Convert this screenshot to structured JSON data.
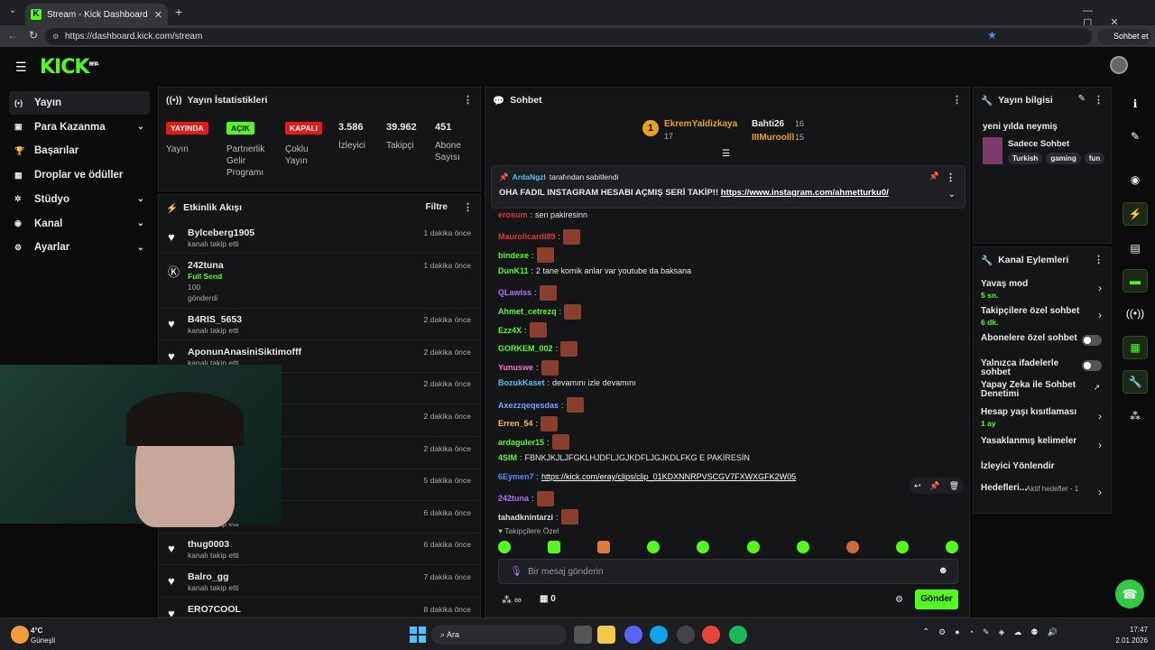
{
  "browser": {
    "tab_title": "Stream - Kick Dashboard",
    "url": "https://dashboard.kick.com/stream",
    "profile_label": "Sohbet et"
  },
  "header": {
    "logo": "KICK",
    "beta": "BETA"
  },
  "sidebar": {
    "items": [
      {
        "label": "Yayın",
        "icon": "stream-icon",
        "chevron": false
      },
      {
        "label": "Para Kazanma",
        "icon": "money-icon",
        "chevron": true
      },
      {
        "label": "Başarılar",
        "icon": "trophy-icon",
        "chevron": false
      },
      {
        "label": "Droplar ve ödüller",
        "icon": "gift-icon",
        "chevron": false
      },
      {
        "label": "Stüdyo",
        "icon": "studio-icon",
        "chevron": true
      },
      {
        "label": "Kanal",
        "icon": "channel-icon",
        "chevron": true
      },
      {
        "label": "Ayarlar",
        "icon": "gear-icon",
        "chevron": true
      }
    ]
  },
  "stats": {
    "title": "Yayın İstatistikleri",
    "items": [
      {
        "badge": "YAYINDA",
        "label": "Yayın"
      },
      {
        "badge": "AÇIK",
        "label": "Partnerlik Gelir Programı"
      },
      {
        "badge": "KAPALI",
        "label": "Çoklu Yayın"
      },
      {
        "value": "3.586",
        "label": "İzleyici"
      },
      {
        "value": "39.962",
        "label": "Takipçi"
      },
      {
        "value": "451",
        "label": "Abone Sayısı"
      }
    ]
  },
  "activity": {
    "title": "Etkinlik Akışı",
    "filter": "Filtre",
    "items": [
      {
        "name": "Bylceberg1905",
        "sub": "kanalı takip etti",
        "time": "1 dakika önce"
      },
      {
        "name": "242tuna",
        "sub": "Full Send",
        "extra": "100",
        "extra2": "gönderdi",
        "time": "1 dakika önce"
      },
      {
        "name": "B4RIS_5653",
        "sub": "kanalı takip etti",
        "time": "2 dakika önce"
      },
      {
        "name": "AponunAnasiniSiktimofff",
        "sub": "kanalı takip etti",
        "time": "2 dakika önce"
      },
      {
        "name": "",
        "sub": "",
        "time": "2 dakika önce"
      },
      {
        "name": "",
        "sub": "",
        "time": "2 dakika önce"
      },
      {
        "name": "",
        "sub": "",
        "time": "2 dakika önce"
      },
      {
        "name": "",
        "sub": "",
        "time": "5 dakika önce"
      },
      {
        "name": "",
        "sub": "kanalı takip etti",
        "time": "6 dakika önce"
      },
      {
        "name": "thug0003",
        "sub": "kanalı takip etti",
        "time": "6 dakika önce"
      },
      {
        "name": "Balro_gg",
        "sub": "kanalı takip etti",
        "time": "7 dakika önce"
      },
      {
        "name": "ERO7COOL",
        "sub": "",
        "time": "8 dakika önce"
      }
    ]
  },
  "chat": {
    "title": "Sohbet",
    "leaders": [
      {
        "name": "EkremYaldizkaya",
        "count": "17"
      },
      {
        "name": "Bahti26",
        "count": "16"
      },
      {
        "name": "IIIMuroolll",
        "count": "15"
      }
    ],
    "pinned_by": "ArdaNgzl",
    "pinned_suffix": "tarafından sabitlendi",
    "pinned_text": "OHA FADIL INSTAGRAM HESABI AÇMIŞ SERİ TAKİP!!",
    "pinned_link": "https://www.instagram.com/ahmetturku0/",
    "messages": [
      {
        "user": "erosum",
        "color": "#e0373a",
        "text": "sen pakiresinn",
        "emote": false
      },
      {
        "user": "Maurolicardi89",
        "color": "#e0373a",
        "text": "",
        "emote": true
      },
      {
        "user": "bindexe",
        "color": "#53fc18",
        "text": "",
        "emote": true
      },
      {
        "user": "DunK11",
        "color": "#53fc18",
        "text": "2 tane komik anlar var youtube da baksana",
        "emote": false
      },
      {
        "user": "QLawiss",
        "color": "#b66cff",
        "text": "",
        "emote": true
      },
      {
        "user": "Ahmet_cetrezq",
        "color": "#53fc18",
        "text": "",
        "emote": true
      },
      {
        "user": "Ezz4X",
        "color": "#53fc18",
        "text": "",
        "emote": true
      },
      {
        "user": "GORKEM_002",
        "color": "#53fc18",
        "text": "",
        "emote": true
      },
      {
        "user": "Yunuswe",
        "color": "#ff6ec7",
        "text": "",
        "emote": true
      },
      {
        "user": "BozukKaset",
        "color": "#4fc3f7",
        "text": "devamını izle devamını",
        "emote": false
      },
      {
        "user": "Axezzqeqesdas",
        "color": "#7aa2ff",
        "text": "",
        "emote": true
      },
      {
        "user": "Erren_54",
        "color": "#ffb74d",
        "text": "",
        "emote": true
      },
      {
        "user": "ardaguler15",
        "color": "#53fc18",
        "text": "",
        "emote": true
      },
      {
        "user": "4SIM",
        "color": "#53fc18",
        "text": "FBNKJKJLJFGKLHJDFLJGJKDFLJGJKDLFKG E PAKİRESİN",
        "emote": false
      },
      {
        "user": "6Eymen7",
        "color": "#4f8cff",
        "text": "",
        "link": "https://kick.com/eray/clips/clip_01KDXNNRPVSCGV7FXWXGFK2W05",
        "emote": false
      },
      {
        "user": "242tuna",
        "color": "#b66cff",
        "text": "",
        "emote": true
      },
      {
        "user": "tahadknintarzi",
        "color": "#ddd",
        "text": "",
        "emote": true
      }
    ],
    "followers_only": "Takipçilere Özel",
    "input_placeholder": "Bir mesaj gönderin",
    "points": "0",
    "send_label": "Gönder"
  },
  "stream_info": {
    "title": "Yayın bilgisi",
    "stream_title": "yeni yılda neymiş",
    "category": "Sadece Sohbet",
    "tags": [
      "Turkish",
      "gaming",
      "fun"
    ]
  },
  "channel_actions": {
    "title": "Kanal Eylemleri",
    "items": [
      {
        "label": "Yavaş mod",
        "sub": "5 sn.",
        "control": "chevron"
      },
      {
        "label": "Takipçilere özel sohbet",
        "sub": "6 dk.",
        "control": "chevron"
      },
      {
        "label": "Abonelere özel sohbet",
        "sub": "",
        "control": "toggle"
      },
      {
        "label": "Yalnızca ifadelerle sohbet",
        "sub": "",
        "control": "toggle"
      },
      {
        "label": "Yapay Zeka ile Sohbet Denetimi",
        "sub": "",
        "control": "external"
      },
      {
        "label": "Hesap yaşı kısıtlaması",
        "sub": "1 ay",
        "control": "chevron"
      },
      {
        "label": "Yasaklanmış kelimeler",
        "sub": "",
        "control": "chevron"
      },
      {
        "label": "İzleyici Yönlendir",
        "sub": "",
        "control": "none"
      },
      {
        "label": "Hedefleri...",
        "sub": "",
        "extra": "Aktif hedefler - 1",
        "control": "chevron"
      }
    ]
  },
  "taskbar": {
    "weather_temp": "4°C",
    "weather_label": "Güneşli",
    "search": "Ara",
    "time": "17:47",
    "date": "2.01.2026"
  },
  "colors": {
    "accent": "#53fc18",
    "live": "#e91916"
  }
}
